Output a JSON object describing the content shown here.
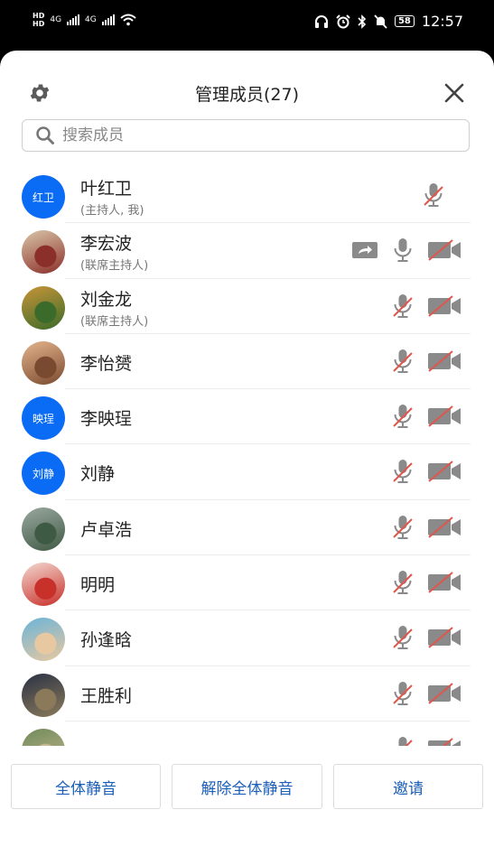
{
  "status_bar": {
    "left": [
      "HD",
      "4G",
      "4G"
    ],
    "battery": "58",
    "time": "12:57"
  },
  "header": {
    "title": "管理成员(27)"
  },
  "search": {
    "placeholder": "搜索成员"
  },
  "members": [
    {
      "name": "叶红卫",
      "role": "(主持人, 我)",
      "avatar_text": "红卫",
      "avatar_type": "text",
      "screen_share": false,
      "mic": "muted",
      "camera": "none"
    },
    {
      "name": "李宏波",
      "role": "(联席主持人)",
      "avatar_type": "photo",
      "avatar_colors": [
        "#d9c6a8",
        "#8b2f2a"
      ],
      "screen_share": true,
      "mic": "on",
      "camera": "off"
    },
    {
      "name": "刘金龙",
      "role": "(联席主持人)",
      "avatar_type": "photo",
      "avatar_colors": [
        "#c89438",
        "#3a6b2a"
      ],
      "screen_share": false,
      "mic": "muted",
      "camera": "off"
    },
    {
      "name": "李怡赟",
      "role": "",
      "avatar_type": "photo",
      "avatar_colors": [
        "#e4b48c",
        "#7a4a30"
      ],
      "screen_share": false,
      "mic": "muted",
      "camera": "off"
    },
    {
      "name": "李映珵",
      "role": "",
      "avatar_text": "映珵",
      "avatar_type": "text",
      "screen_share": false,
      "mic": "muted",
      "camera": "off"
    },
    {
      "name": "刘静",
      "role": "",
      "avatar_text": "刘静",
      "avatar_type": "text",
      "screen_share": false,
      "mic": "muted",
      "camera": "off"
    },
    {
      "name": "卢卓浩",
      "role": "",
      "avatar_type": "photo",
      "avatar_colors": [
        "#9aa8a0",
        "#3f5a44"
      ],
      "screen_share": false,
      "mic": "muted",
      "camera": "off"
    },
    {
      "name": "明明",
      "role": "",
      "avatar_type": "photo",
      "avatar_colors": [
        "#f3d8d0",
        "#c8302a"
      ],
      "screen_share": false,
      "mic": "muted",
      "camera": "off"
    },
    {
      "name": "孙逢晗",
      "role": "",
      "avatar_type": "photo",
      "avatar_colors": [
        "#6bb4d8",
        "#e8c8a0"
      ],
      "screen_share": false,
      "mic": "muted",
      "camera": "off"
    },
    {
      "name": "王胜利",
      "role": "",
      "avatar_type": "photo",
      "avatar_colors": [
        "#2b3245",
        "#8a7a5a"
      ],
      "screen_share": false,
      "mic": "muted",
      "camera": "off"
    },
    {
      "name": "",
      "role": "",
      "avatar_type": "photo",
      "avatar_colors": [
        "#6f8a5a",
        "#c8b890"
      ],
      "screen_share": false,
      "mic": "muted",
      "camera": "off"
    }
  ],
  "actions": {
    "mute_all": "全体静音",
    "unmute_all": "解除全体静音",
    "invite": "邀请"
  },
  "colors": {
    "accent": "#0a6cf5",
    "button_text": "#1b5fb8",
    "muted_slash": "#e0564c",
    "icon_gray": "#8a8a8a"
  }
}
